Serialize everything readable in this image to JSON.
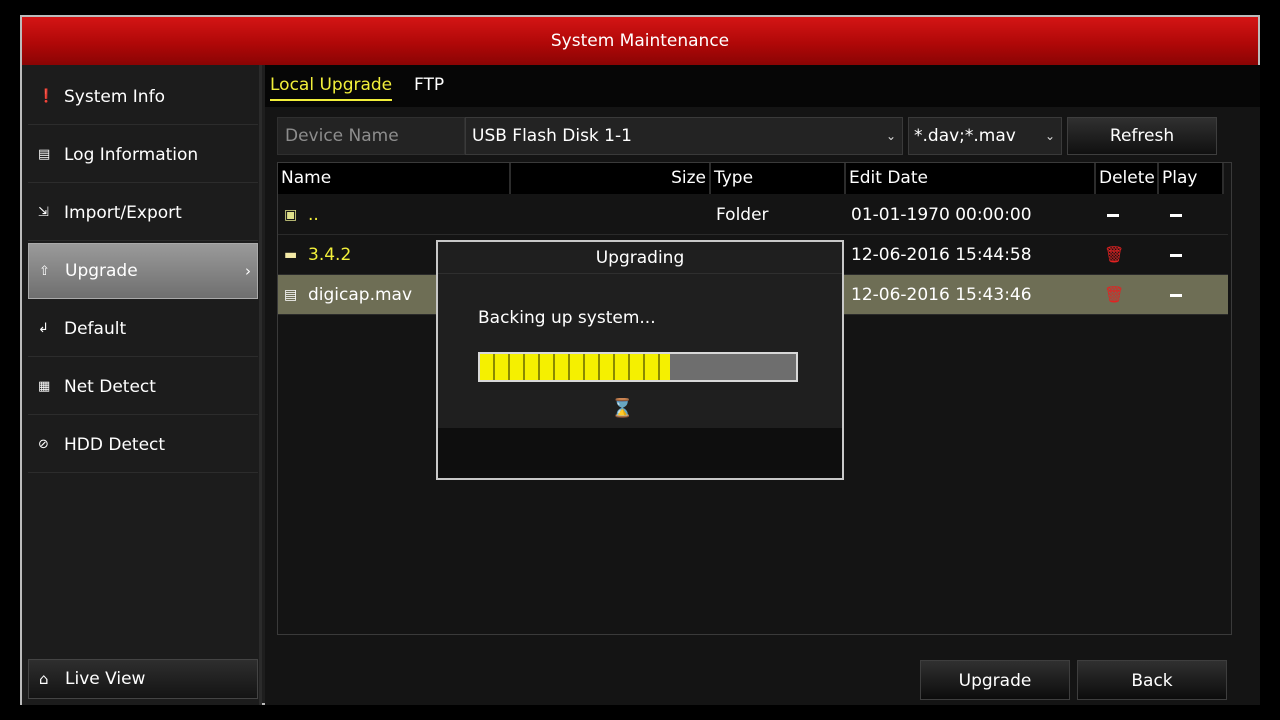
{
  "window": {
    "title": "System Maintenance"
  },
  "sidebar": {
    "items": [
      {
        "label": "System Info",
        "icon": "info-icon"
      },
      {
        "label": "Log Information",
        "icon": "log-icon"
      },
      {
        "label": "Import/Export",
        "icon": "import-export-icon"
      },
      {
        "label": "Upgrade",
        "icon": "upgrade-icon",
        "active": true
      },
      {
        "label": "Default",
        "icon": "default-icon"
      },
      {
        "label": "Net Detect",
        "icon": "network-icon"
      },
      {
        "label": "HDD Detect",
        "icon": "hdd-icon"
      }
    ],
    "live_view": "Live View"
  },
  "tabs": [
    {
      "label": "Local Upgrade",
      "active": true
    },
    {
      "label": "FTP"
    }
  ],
  "device": {
    "label": "Device Name",
    "value": "USB Flash Disk 1-1",
    "filetype": "*.dav;*.mav",
    "refresh_label": "Refresh"
  },
  "table": {
    "headers": {
      "name": "Name",
      "size": "Size",
      "type": "Type",
      "edit_date": "Edit Date",
      "delete": "Delete",
      "play": "Play"
    },
    "rows": [
      {
        "name": "..",
        "size": "",
        "type": "Folder",
        "edit_date": "01-01-1970 00:00:00",
        "icon": "parent-folder-icon"
      },
      {
        "name": "3.4.2",
        "size": "",
        "type": "",
        "edit_date": "12-06-2016 15:44:58",
        "icon": "folder-icon"
      },
      {
        "name": "digicap.mav",
        "size": "",
        "type": "",
        "edit_date": "12-06-2016 15:43:46",
        "icon": "file-icon",
        "selected": true
      }
    ]
  },
  "buttons": {
    "upgrade": "Upgrade",
    "back": "Back"
  },
  "dialog": {
    "title": "Upgrading",
    "message": "Backing up system...",
    "progress": 0.6
  },
  "colors": {
    "title_red": "#c01010",
    "highlight_yellow": "#f2ef3a",
    "delete_red": "#e22222"
  }
}
